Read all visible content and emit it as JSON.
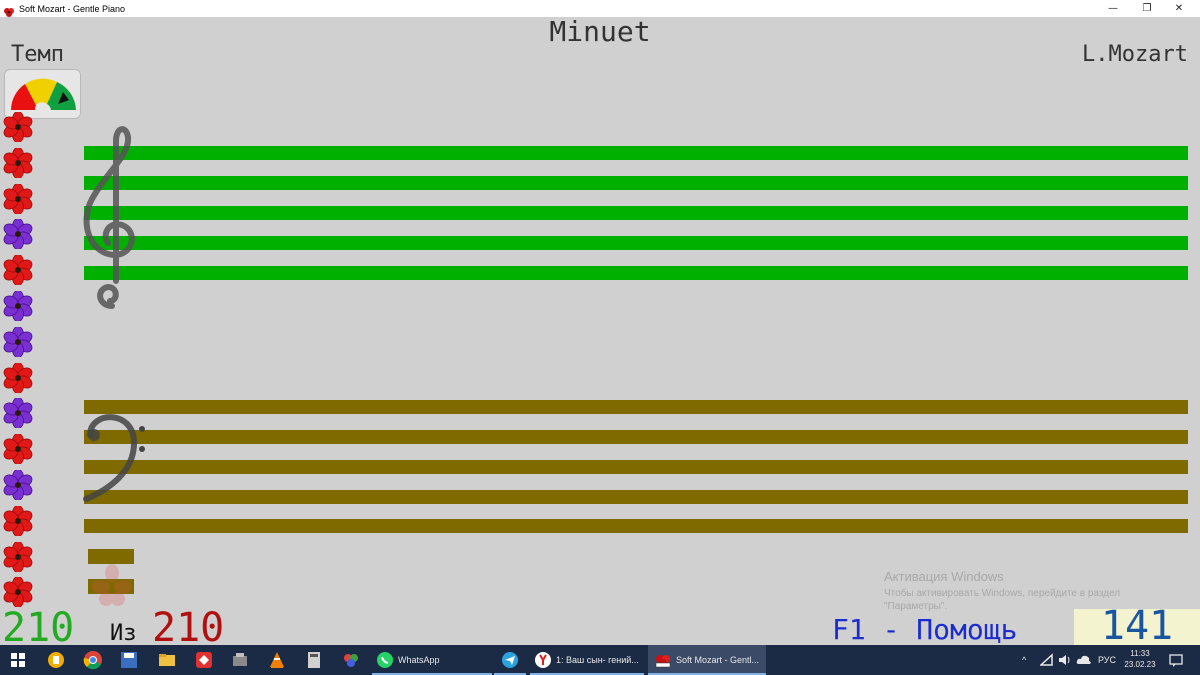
{
  "window": {
    "title": "Soft Mozart - Gentle Piano",
    "controls": {
      "minimize": "—",
      "maximize": "❐",
      "close": "✕"
    }
  },
  "score": {
    "piece_title": "Minuet",
    "composer": "L.Mozart",
    "tempo_label": "Темп",
    "current": "210",
    "of_label": "Из",
    "total": "210",
    "help": "F1 - Помощь",
    "counter": "141"
  },
  "flowers": [
    "red",
    "red",
    "red",
    "purple",
    "red",
    "purple",
    "purple",
    "red",
    "purple",
    "red",
    "purple",
    "red",
    "red",
    "red"
  ],
  "colors": {
    "treble_staff": "#00b000",
    "bass_staff": "#7f6a00",
    "background": "#d0d0d0",
    "score_current": "#22aa22",
    "score_total": "#b01010",
    "help_text": "#1a2bd0",
    "counter_text": "#1a55a0"
  },
  "watermark": {
    "title": "Активация Windows",
    "line1": "Чтобы активировать Windows, перейдите в раздел",
    "line2": "\"Параметры\"."
  },
  "taskbar": {
    "pinned_icons": [
      "windows-start-icon",
      "file-manager-icon",
      "chrome-icon",
      "save-disk-icon",
      "folder-icon",
      "anydesk-icon",
      "tool-icon",
      "vlc-icon",
      "calculator-icon",
      "paint-icon"
    ],
    "apps": [
      {
        "label": "WhatsApp",
        "icon": "whatsapp-icon"
      },
      {
        "label": "",
        "icon": "telegram-icon"
      },
      {
        "label": "1: Ваш сын- гений...",
        "icon": "yandex-browser-icon"
      },
      {
        "label": "Soft Mozart - Gentl...",
        "icon": "soft-mozart-icon"
      }
    ],
    "tray": {
      "chevron": "^",
      "language": "РУС",
      "time": "11:33",
      "date": "23.02.23"
    }
  }
}
